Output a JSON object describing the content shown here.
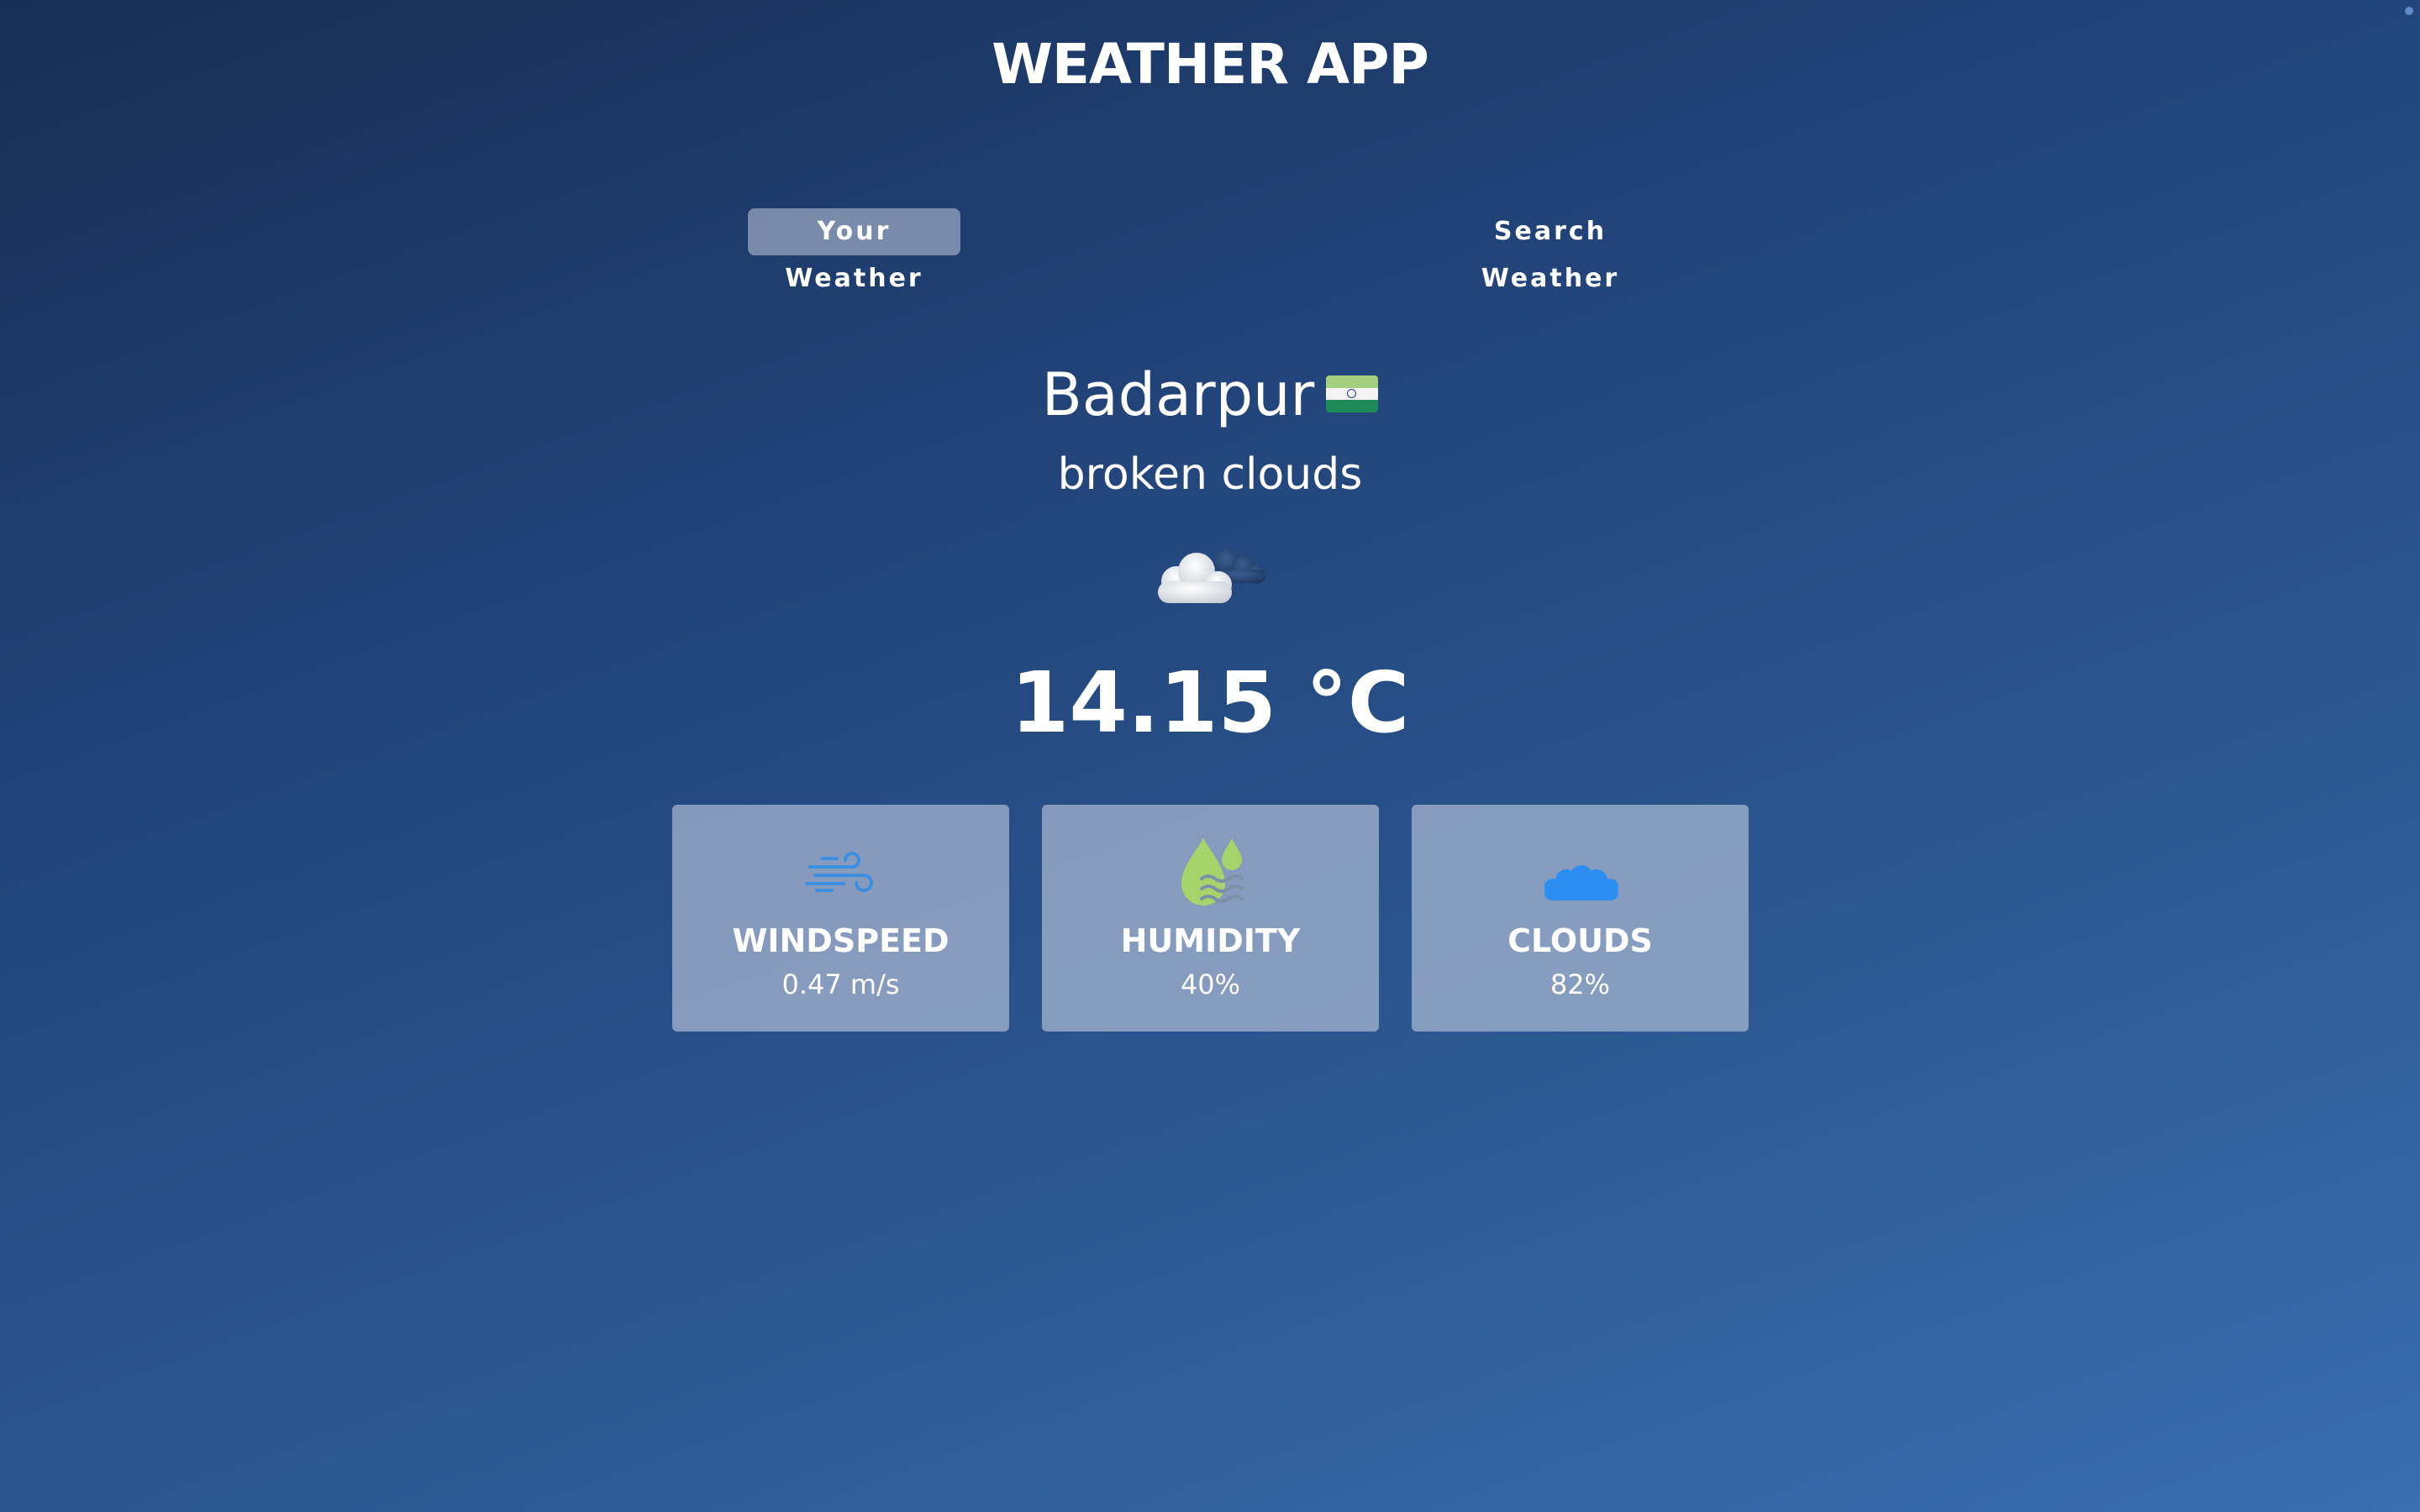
{
  "app": {
    "title": "WEATHER APP"
  },
  "tabs": [
    {
      "label": "Your Weather",
      "active": true
    },
    {
      "label": "Search Weather",
      "active": false
    }
  ],
  "location": {
    "city": "Badarpur",
    "flag_icon": "india-flag-icon"
  },
  "weather": {
    "description": "broken clouds",
    "icon": "broken-clouds-icon",
    "temperature": "14.15 °C"
  },
  "stats": [
    {
      "label": "WINDSPEED",
      "value": "0.47 m/s",
      "icon": "wind-icon",
      "icon_color": "#3b8fe0"
    },
    {
      "label": "HUMIDITY",
      "value": "40%",
      "icon": "humidity-icon",
      "icon_color": "#a6d46b"
    },
    {
      "label": "CLOUDS",
      "value": "82%",
      "icon": "cloud-icon",
      "icon_color": "#2b8ef0"
    }
  ],
  "colors": {
    "background_top": "#172f55",
    "background_bottom": "#3a6eaf",
    "card_background": "#aab9d2",
    "active_tab_background": "#b4c0d6"
  }
}
